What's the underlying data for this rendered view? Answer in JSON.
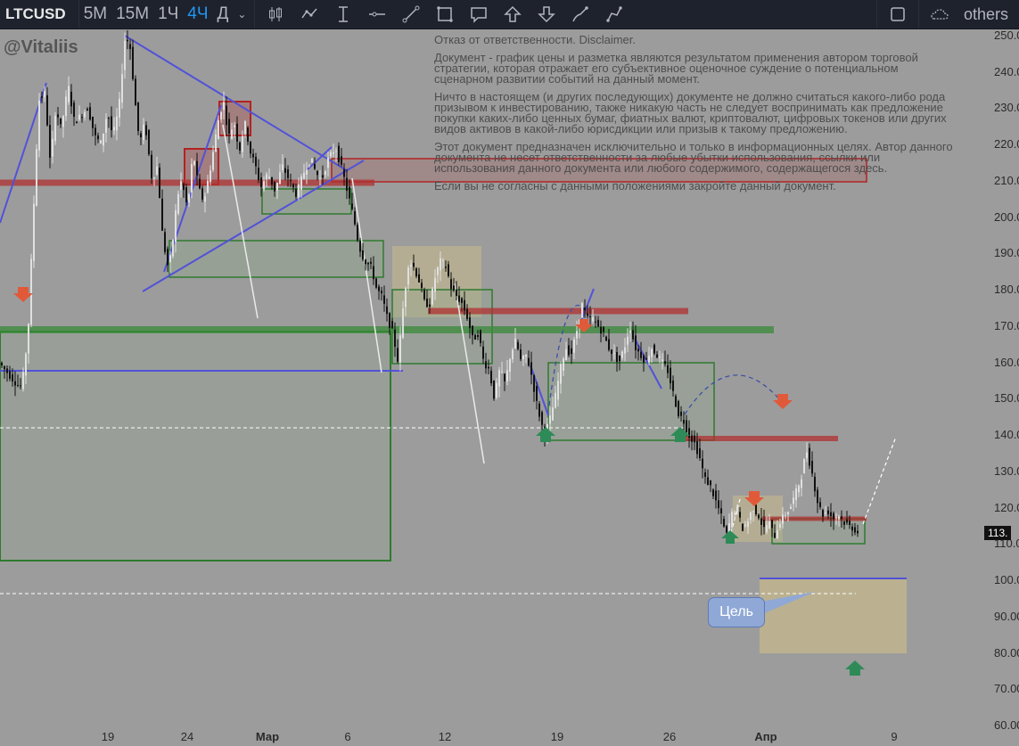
{
  "toolbar": {
    "symbol": "LTCUSD",
    "intervals": [
      {
        "label": "5М",
        "active": false
      },
      {
        "label": "15М",
        "active": false
      },
      {
        "label": "1Ч",
        "active": false
      },
      {
        "label": "4Ч",
        "active": true
      },
      {
        "label": "Д",
        "active": false
      }
    ],
    "tools": [
      "candles-icon",
      "indicators-icon",
      "cursor-icon",
      "horizontal-line-icon",
      "trend-line-icon",
      "rectangle-icon",
      "callout-icon",
      "arrow-up-icon",
      "arrow-down-icon",
      "brush-icon",
      "path-icon"
    ],
    "layout_label": "others"
  },
  "author": "@Vitaliis",
  "disclaimer": [
    "Отказ от ответственности. Disclaimer.",
    "Документ - график цены и разметка являются результатом применения автором торговой стратегии, которая отражает его субъективное оценочное суждение о потенциальном сценарном развитии событий на данный момент.",
    "Ничто в настоящем (и других последующих) документе не должно считаться какого-либо рода призывом к инвестированию, также никакую часть не следует воспринимать как предложение покупки каких-либо ценных бумаг, фиатных валют, криптовалют, цифровых токенов или других видов активов в какой-либо юрисдикции или призыв к такому предложению.",
    "Этот документ предназначен исключительно и только в информационных целях. Автор данного документа не несет ответственности за любые убытки использования, ссылки или использования данного документа или любого содержимого, содержащегося здесь.",
    "Если вы не согласны с данными положениями закройте данный документ."
  ],
  "annotation": "Цель",
  "price_tag": "113.",
  "price_axis": [
    "250.0",
    "240.0",
    "230.0",
    "220.0",
    "210.0",
    "200.0",
    "190.0",
    "180.0",
    "170.0",
    "160.0",
    "150.0",
    "140.0",
    "130.0",
    "120.0",
    "110.0",
    "100.0",
    "90.00",
    "80.00",
    "70.00",
    "60.00"
  ],
  "time_axis": [
    {
      "label": "19",
      "bold": false
    },
    {
      "label": "24",
      "bold": false
    },
    {
      "label": "Мар",
      "bold": true
    },
    {
      "label": "6",
      "bold": false
    },
    {
      "label": "12",
      "bold": false
    },
    {
      "label": "19",
      "bold": false
    },
    {
      "label": "26",
      "bold": false
    },
    {
      "label": "Апр",
      "bold": true
    },
    {
      "label": "9",
      "bold": false
    }
  ],
  "colors": {
    "background": "#9c9c9c",
    "toolbar": "#1e222d",
    "active_interval": "#2196f3",
    "candle": "#111111",
    "wick_light": "#e0e0e0",
    "zone_green": "#3a8a3a",
    "zone_red": "#b22222",
    "trend_blue": "#5252d9",
    "target_zone": "#c9bb8c"
  },
  "chart_data": {
    "type": "candlestick",
    "symbol": "LTCUSD",
    "timeframe": "4Ч",
    "x_ticks": [
      "19",
      "24",
      "Мар",
      "6",
      "12",
      "19",
      "26",
      "Апр",
      "9"
    ],
    "y_ticks": [
      250,
      240,
      230,
      220,
      210,
      200,
      190,
      180,
      170,
      160,
      150,
      140,
      130,
      120,
      110,
      100,
      90,
      80,
      70,
      60
    ],
    "ylim": [
      58,
      252
    ],
    "last_price": 113,
    "path": [
      [
        0,
        160
      ],
      [
        10,
        157
      ],
      [
        20,
        154
      ],
      [
        26,
        153
      ],
      [
        33,
        168
      ],
      [
        38,
        196
      ],
      [
        45,
        232
      ],
      [
        52,
        234
      ],
      [
        58,
        214
      ],
      [
        64,
        230
      ],
      [
        70,
        224
      ],
      [
        78,
        236
      ],
      [
        85,
        226
      ],
      [
        93,
        228
      ],
      [
        100,
        230
      ],
      [
        108,
        222
      ],
      [
        115,
        220
      ],
      [
        122,
        229
      ],
      [
        128,
        222
      ],
      [
        135,
        230
      ],
      [
        142,
        250
      ],
      [
        148,
        246
      ],
      [
        152,
        234
      ],
      [
        158,
        220
      ],
      [
        164,
        226
      ],
      [
        172,
        210
      ],
      [
        178,
        214
      ],
      [
        184,
        194
      ],
      [
        190,
        186
      ],
      [
        194,
        190
      ],
      [
        200,
        205
      ],
      [
        205,
        210
      ],
      [
        212,
        202
      ],
      [
        218,
        218
      ],
      [
        224,
        208
      ],
      [
        230,
        204
      ],
      [
        238,
        214
      ],
      [
        246,
        226
      ],
      [
        252,
        232
      ],
      [
        258,
        222
      ],
      [
        264,
        226
      ],
      [
        270,
        218
      ],
      [
        276,
        226
      ],
      [
        282,
        218
      ],
      [
        288,
        214
      ],
      [
        294,
        208
      ],
      [
        302,
        212
      ],
      [
        310,
        207
      ],
      [
        318,
        214
      ],
      [
        326,
        210
      ],
      [
        334,
        206
      ],
      [
        342,
        212
      ],
      [
        350,
        216
      ],
      [
        356,
        212
      ],
      [
        362,
        210
      ],
      [
        370,
        216
      ],
      [
        378,
        219
      ],
      [
        386,
        212
      ],
      [
        392,
        206
      ],
      [
        398,
        200
      ],
      [
        404,
        192
      ],
      [
        410,
        188
      ],
      [
        418,
        186
      ],
      [
        424,
        180
      ],
      [
        430,
        178
      ],
      [
        436,
        172
      ],
      [
        442,
        168
      ],
      [
        448,
        160
      ],
      [
        454,
        176
      ],
      [
        460,
        188
      ],
      [
        466,
        186
      ],
      [
        472,
        182
      ],
      [
        478,
        176
      ],
      [
        484,
        176
      ],
      [
        490,
        184
      ],
      [
        496,
        188
      ],
      [
        502,
        186
      ],
      [
        508,
        180
      ],
      [
        514,
        178
      ],
      [
        520,
        176
      ],
      [
        526,
        172
      ],
      [
        532,
        166
      ],
      [
        538,
        168
      ],
      [
        544,
        160
      ],
      [
        550,
        158
      ],
      [
        556,
        150
      ],
      [
        562,
        158
      ],
      [
        568,
        154
      ],
      [
        574,
        162
      ],
      [
        580,
        166
      ],
      [
        586,
        160
      ],
      [
        592,
        162
      ],
      [
        598,
        156
      ],
      [
        604,
        148
      ],
      [
        612,
        140
      ],
      [
        618,
        144
      ],
      [
        624,
        150
      ],
      [
        630,
        158
      ],
      [
        636,
        164
      ],
      [
        642,
        162
      ],
      [
        648,
        168
      ],
      [
        654,
        176
      ],
      [
        660,
        172
      ],
      [
        666,
        172
      ],
      [
        672,
        170
      ],
      [
        678,
        168
      ],
      [
        684,
        164
      ],
      [
        690,
        162
      ],
      [
        696,
        160
      ],
      [
        702,
        164
      ],
      [
        708,
        170
      ],
      [
        714,
        164
      ],
      [
        720,
        162
      ],
      [
        726,
        160
      ],
      [
        732,
        164
      ],
      [
        738,
        162
      ],
      [
        744,
        160
      ],
      [
        750,
        158
      ],
      [
        756,
        152
      ],
      [
        762,
        146
      ],
      [
        768,
        144
      ],
      [
        774,
        140
      ],
      [
        780,
        138
      ],
      [
        786,
        134
      ],
      [
        792,
        128
      ],
      [
        798,
        126
      ],
      [
        804,
        122
      ],
      [
        810,
        118
      ],
      [
        816,
        112
      ],
      [
        822,
        118
      ],
      [
        828,
        120
      ],
      [
        834,
        114
      ],
      [
        840,
        116
      ],
      [
        846,
        120
      ],
      [
        852,
        118
      ],
      [
        858,
        114
      ],
      [
        864,
        116
      ],
      [
        870,
        112
      ],
      [
        876,
        116
      ],
      [
        882,
        118
      ],
      [
        888,
        120
      ],
      [
        894,
        124
      ],
      [
        900,
        128
      ],
      [
        906,
        136
      ],
      [
        912,
        130
      ],
      [
        918,
        122
      ],
      [
        924,
        118
      ],
      [
        930,
        119
      ],
      [
        936,
        117
      ],
      [
        942,
        118
      ],
      [
        948,
        116
      ],
      [
        954,
        115
      ],
      [
        960,
        114
      ],
      [
        964,
        113
      ]
    ],
    "horizontal_zones": [
      {
        "type": "resistance",
        "price": 209.5
      },
      {
        "type": "resistance",
        "price": 174
      },
      {
        "type": "support",
        "price": 169.5
      },
      {
        "type": "resistance",
        "price": 139
      },
      {
        "type": "resistance",
        "price": 116.5
      }
    ],
    "levels": [
      {
        "price": 157
      },
      {
        "price": 142
      },
      {
        "price": 96
      },
      {
        "price": 101
      }
    ],
    "target_zone": [
      80,
      101
    ],
    "annotation": "Цель"
  }
}
